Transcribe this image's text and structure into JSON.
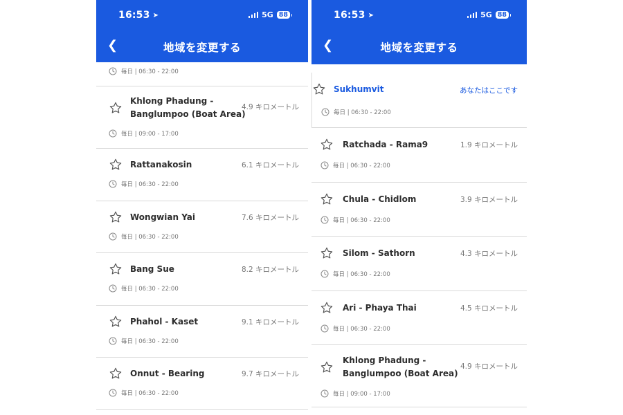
{
  "status": {
    "time": "16:53",
    "network": "5G",
    "battery": "88"
  },
  "header": {
    "title": "地域を変更する",
    "back_icon": "chevron-left-icon"
  },
  "colors": {
    "accent": "#1a5ae0",
    "text": "#2d2d2d",
    "muted": "#777777"
  },
  "left": {
    "partial_hours": "毎日 | 06:30 - 22:00",
    "items": [
      {
        "name_line1": "Khlong Phadung -",
        "name_line2": "Banglumpoo (Boat Area)",
        "distance": "4.9 キロメートル",
        "hours": "毎日 | 09:00 - 17:00"
      },
      {
        "name_line1": "Rattanakosin",
        "distance": "6.1 キロメートル",
        "hours": "毎日 | 06:30 - 22:00"
      },
      {
        "name_line1": "Wongwian Yai",
        "distance": "7.6 キロメートル",
        "hours": "毎日 | 06:30 - 22:00"
      },
      {
        "name_line1": "Bang Sue",
        "distance": "8.2 キロメートル",
        "hours": "毎日 | 06:30 - 22:00"
      },
      {
        "name_line1": "Phahol - Kaset",
        "distance": "9.1 キロメートル",
        "hours": "毎日 | 06:30 - 22:00"
      },
      {
        "name_line1": "Onnut - Bearing",
        "distance": "9.7 キロメートル",
        "hours": "毎日 | 06:30 - 22:00"
      }
    ]
  },
  "right": {
    "current": {
      "name": "Sukhumvit",
      "label": "あなたはここです",
      "hours": "毎日 | 06:30 - 22:00"
    },
    "items": [
      {
        "name_line1": "Ratchada - Rama9",
        "distance": "1.9 キロメートル",
        "hours": "毎日 | 06:30 - 22:00"
      },
      {
        "name_line1": "Chula - Chidlom",
        "distance": "3.9 キロメートル",
        "hours": "毎日 | 06:30 - 22:00"
      },
      {
        "name_line1": "Silom - Sathorn",
        "distance": "4.3 キロメートル",
        "hours": "毎日 | 06:30 - 22:00"
      },
      {
        "name_line1": "Ari - Phaya Thai",
        "distance": "4.5 キロメートル",
        "hours": "毎日 | 06:30 - 22:00"
      },
      {
        "name_line1": "Khlong Phadung -",
        "name_line2": "Banglumpoo (Boat Area)",
        "distance": "4.9 キロメートル",
        "hours": "毎日 | 09:00 - 17:00"
      }
    ]
  }
}
